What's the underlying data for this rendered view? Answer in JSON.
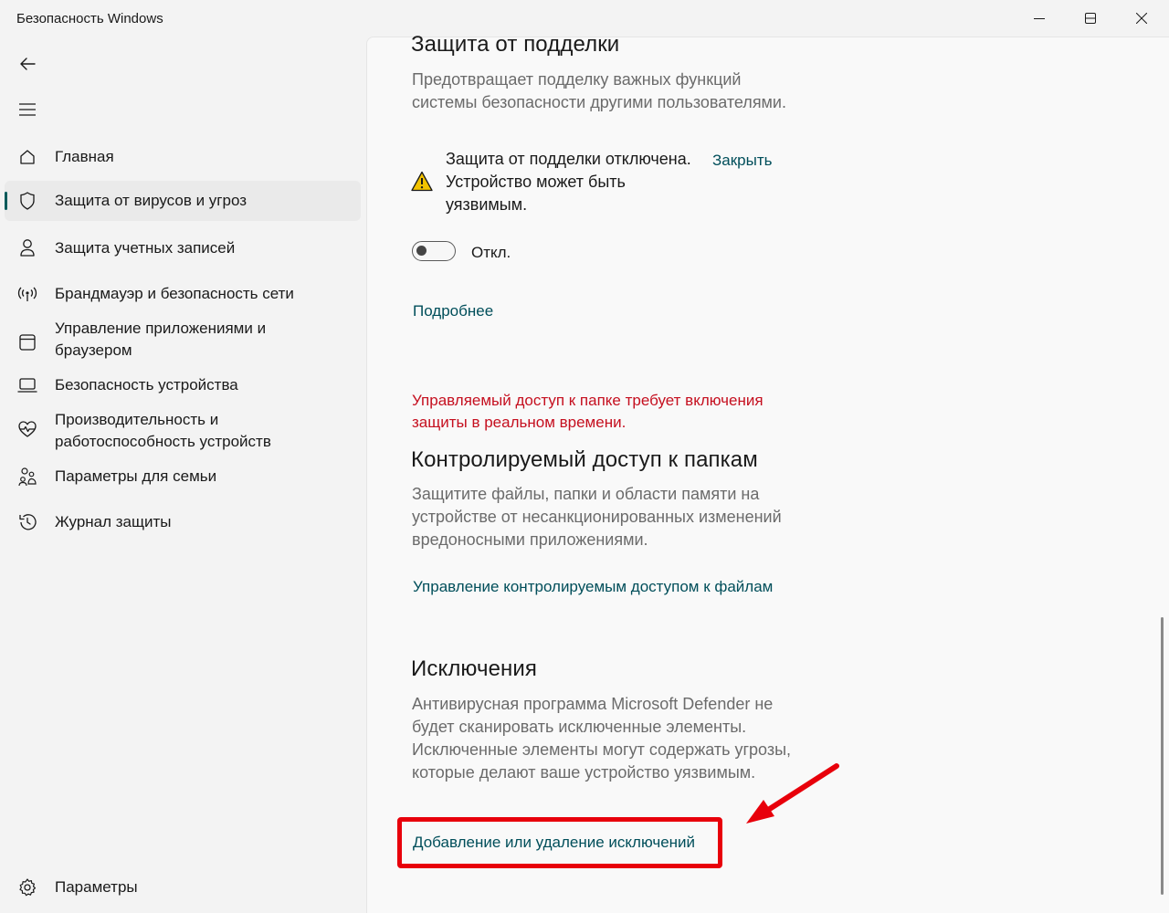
{
  "window": {
    "title": "Безопасность Windows",
    "controls": [
      "minimize",
      "maximize",
      "close"
    ]
  },
  "sidebar": {
    "items": [
      {
        "label": "Главная",
        "icon": "home-icon"
      },
      {
        "label": "Защита от вирусов и угроз",
        "icon": "shield-icon",
        "active": true
      },
      {
        "label": "Защита учетных записей",
        "icon": "person-icon"
      },
      {
        "label": "Брандмауэр и безопасность сети",
        "icon": "wifi-broadcast-icon"
      },
      {
        "label": "Управление приложениями и браузером",
        "icon": "app-window-icon"
      },
      {
        "label": "Безопасность устройства",
        "icon": "laptop-icon"
      },
      {
        "label": "Производительность и работоспособность устройств",
        "icon": "heart-pulse-icon"
      },
      {
        "label": "Параметры для семьи",
        "icon": "family-icon"
      },
      {
        "label": "Журнал защиты",
        "icon": "history-icon"
      }
    ],
    "settings_label": "Параметры"
  },
  "tamper": {
    "title": "Защита от подделки",
    "description": "Предотвращает подделку важных функций системы безопасности другими пользователями.",
    "warning": "Защита от подделки отключена. Устройство может быть уязвимым.",
    "dismiss_label": "Закрыть",
    "toggle_state": "Откл.",
    "toggle_on": false,
    "more_link": "Подробнее"
  },
  "folder_access": {
    "error": "Управляемый доступ к папке требует включения защиты в реальном времени.",
    "title": "Контролируемый доступ к папкам",
    "description": "Защитите файлы, папки и области памяти на устройстве от несанкционированных изменений вредоносными приложениями.",
    "manage_link": "Управление контролируемым доступом к файлам"
  },
  "exclusions": {
    "title": "Исключения",
    "description": "Антивирусная программа Microsoft Defender не будет сканировать исключенные элементы. Исключенные элементы могут содержать угрозы, которые делают ваше устройство уязвимым.",
    "add_remove_link": "Добавление или удаление исключений"
  },
  "colors": {
    "accent": "#005a5a",
    "link": "#004e5a",
    "error": "#c50f1f",
    "annotation": "#e8000b"
  }
}
